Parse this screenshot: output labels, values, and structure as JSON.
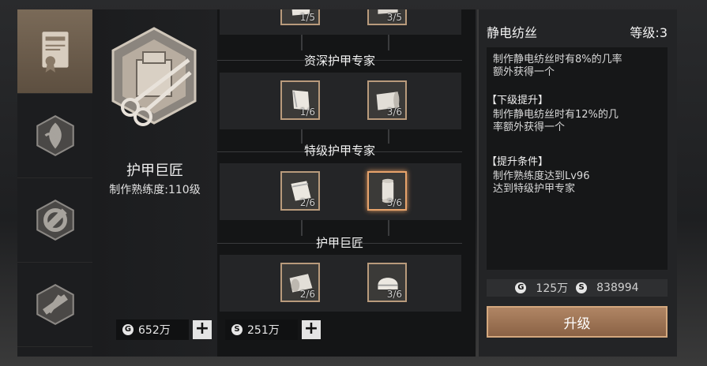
{
  "tabs": [
    {
      "icon": "certificate-icon"
    },
    {
      "icon": "herb-crafting-icon"
    },
    {
      "icon": "gear-hammer-icon"
    },
    {
      "icon": "weapon-crafting-icon"
    }
  ],
  "profession": {
    "name": "护甲巨匠",
    "level": "制作熟练度:110级",
    "emblem_icon": "armor-scissors-emblem"
  },
  "tree": {
    "tiers": [
      {
        "title": "",
        "nodes": [
          {
            "icon": "cloth-icon",
            "count": "1/5"
          },
          {
            "icon": "fabric-icon",
            "count": "3/5"
          }
        ]
      },
      {
        "title": "资深护甲专家",
        "nodes": [
          {
            "icon": "fabric-sheet-icon",
            "count": "1/6"
          },
          {
            "icon": "fabric-roll-icon",
            "count": "3/6"
          }
        ]
      },
      {
        "title": "特级护甲专家",
        "nodes": [
          {
            "icon": "fabric-sheet-icon",
            "count": "2/6"
          },
          {
            "icon": "thread-spool-icon",
            "count": "3/6"
          }
        ]
      },
      {
        "title": "护甲巨匠",
        "nodes": [
          {
            "icon": "fabric-roll-icon",
            "count": "2/6"
          },
          {
            "icon": "helmet-cloth-icon",
            "count": "3/6"
          }
        ]
      }
    ]
  },
  "currency": {
    "gold": "652万",
    "silver": "251万"
  },
  "detail": {
    "title": "静电纺丝",
    "level": "等级:3",
    "desc": [
      "制作静电纺丝时有8%的几率",
      "额外获得一个"
    ],
    "next_head": "【下级提升】",
    "next": [
      "制作静电纺丝时有12%的几",
      "率额外获得一个"
    ],
    "cond_head": "【提升条件】",
    "cond": [
      "制作熟练度达到Lv96",
      "达到特级护甲专家"
    ],
    "cost_gold": "125万",
    "cost_silver": "838994",
    "button": "升级"
  }
}
